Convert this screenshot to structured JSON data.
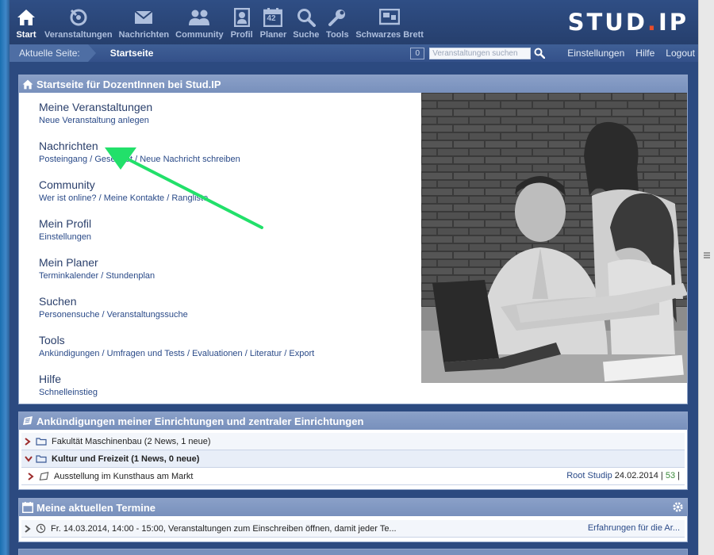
{
  "nav": {
    "items": [
      {
        "label": "Start",
        "icon": "home-icon",
        "active": true
      },
      {
        "label": "Veranstaltungen",
        "icon": "courses-icon"
      },
      {
        "label": "Nachrichten",
        "icon": "mail-icon"
      },
      {
        "label": "Community",
        "icon": "community-icon"
      },
      {
        "label": "Profil",
        "icon": "profile-icon"
      },
      {
        "label": "Planer",
        "icon": "calendar-icon"
      },
      {
        "label": "Suche",
        "icon": "search-icon"
      },
      {
        "label": "Tools",
        "icon": "wrench-icon"
      },
      {
        "label": "Schwarzes Brett",
        "icon": "board-icon"
      }
    ],
    "planer_day": "42",
    "logo_text": "STUD",
    "logo_dot": ".",
    "logo_suffix": "IP"
  },
  "breadcrumb": {
    "label": "Aktuelle Seite:",
    "current": "Startseite",
    "count": "0",
    "search_placeholder": "Veranstaltungen suchen",
    "links": [
      "Einstellungen",
      "Hilfe",
      "Logout"
    ]
  },
  "home": {
    "title": "Startseite für DozentInnen bei Stud.IP",
    "sections": [
      {
        "title": "Meine Veranstaltungen",
        "subs": [
          "Neue Veranstaltung anlegen"
        ]
      },
      {
        "title": "Nachrichten",
        "subs": [
          "Posteingang",
          "Gesendet",
          "Neue Nachricht schreiben"
        ]
      },
      {
        "title": "Community",
        "subs": [
          "Wer ist online?",
          "Meine Kontakte",
          "Rangliste"
        ]
      },
      {
        "title": "Mein Profil",
        "subs": [
          "Einstellungen"
        ]
      },
      {
        "title": "Mein Planer",
        "subs": [
          "Terminkalender",
          "Stundenplan"
        ]
      },
      {
        "title": "Suchen",
        "subs": [
          "Personensuche",
          "Veranstaltungssuche"
        ]
      },
      {
        "title": "Tools",
        "subs": [
          "Ankündigungen",
          "Umfragen und Tests",
          "Evaluationen",
          "Literatur",
          "Export"
        ]
      },
      {
        "title": "Hilfe",
        "subs": [
          "Schnelleinstieg"
        ]
      }
    ]
  },
  "announcements": {
    "title": "Ankündigungen meiner Einrichtungen und zentraler Einrichtungen",
    "rows": [
      {
        "text": "Fakultät Maschinenbau (2 News, 1 neue)"
      },
      {
        "text": "Kultur und Freizeit (1 News, 0 neue)"
      }
    ],
    "news": {
      "text": "Ausstellung im Kunsthaus am Markt",
      "author": "Root Studip",
      "date": "24.02.2014",
      "sep1": "|",
      "views": "53",
      "sep2": "|"
    }
  },
  "dates": {
    "title": "Meine aktuellen Termine",
    "row": {
      "text": "Fr. 14.03.2014, 14:00 - 15:00, Veranstaltungen zum Einschreiben öffnen, damit jeder Te...",
      "link": "Erfahrungen für die Ar..."
    }
  },
  "colors": {
    "brand_blue": "#2c4a80",
    "panel_head": "#7890bc",
    "link": "#2a4a88",
    "logo_dot": "#e84d2a",
    "arrow": "#22e06a"
  }
}
